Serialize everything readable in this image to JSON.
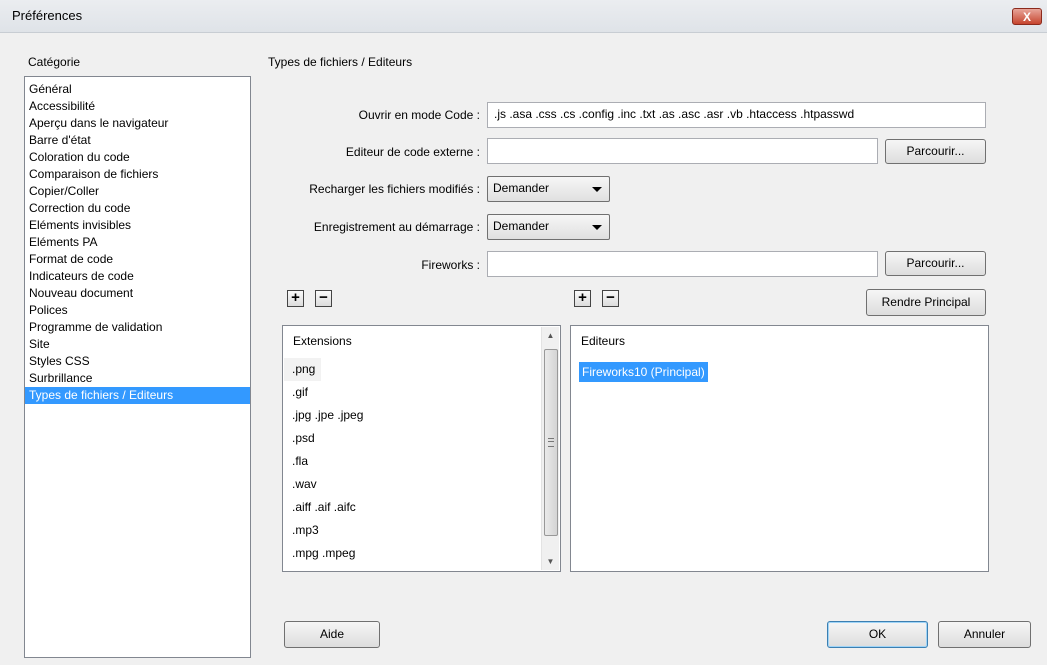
{
  "window": {
    "title": "Préférences",
    "close_label": "X"
  },
  "category": {
    "header": "Catégorie",
    "items": [
      "Général",
      "Accessibilité",
      "Aperçu dans le navigateur",
      "Barre d'état",
      "Coloration du code",
      "Comparaison de fichiers",
      "Copier/Coller",
      "Correction du code",
      "Eléments invisibles",
      "Eléments PA",
      "Format de code",
      "Indicateurs de code",
      "Nouveau document",
      "Polices",
      "Programme de validation",
      "Site",
      "Styles CSS",
      "Surbrillance",
      "Types de fichiers / Editeurs"
    ],
    "selected": "Types de fichiers / Editeurs"
  },
  "panel": {
    "title": "Types de fichiers / Editeurs",
    "open_code_label": "Ouvrir en mode Code :",
    "open_code_value": ".js .asa .css .cs .config .inc .txt .as .asc .asr .vb .htaccess .htpasswd",
    "external_editor_label": "Editeur de code externe :",
    "external_editor_value": "",
    "browse_label": "Parcourir...",
    "reload_label": "Recharger les fichiers modifiés :",
    "reload_value": "Demander",
    "save_on_start_label": "Enregistrement au démarrage :",
    "save_on_start_value": "Demander",
    "fireworks_label": "Fireworks :",
    "fireworks_value": "",
    "plus_label": "+",
    "minus_label": "−",
    "make_primary_label": "Rendre Principal",
    "extensions_header": "Extensions",
    "extensions": [
      ".png",
      ".gif",
      ".jpg .jpe .jpeg",
      ".psd",
      ".fla",
      ".wav",
      ".aiff .aif .aifc",
      ".mp3",
      ".mpg .mpeg"
    ],
    "editors_header": "Editeurs",
    "editors": [
      "Fireworks10 (Principal)"
    ]
  },
  "footer": {
    "help_label": "Aide",
    "ok_label": "OK",
    "cancel_label": "Annuler"
  }
}
